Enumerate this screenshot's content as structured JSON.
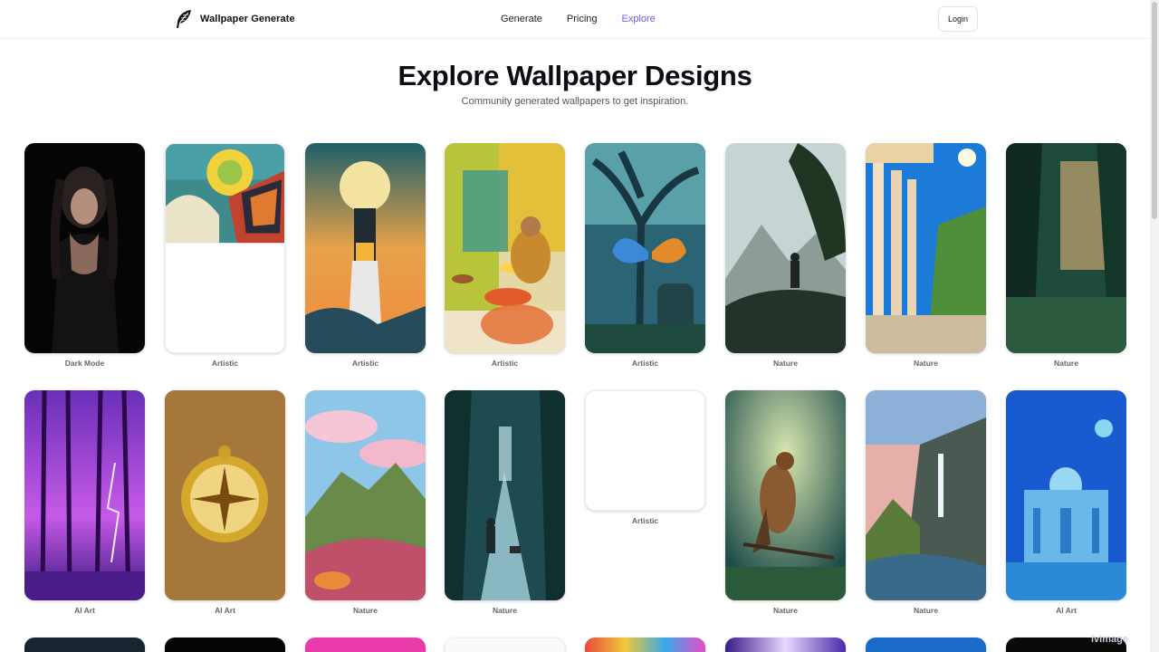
{
  "header": {
    "brand": "Wallpaper Generate",
    "nav": [
      {
        "label": "Generate",
        "active": false
      },
      {
        "label": "Pricing",
        "active": false
      },
      {
        "label": "Explore",
        "active": true
      }
    ],
    "login_label": "Login"
  },
  "hero": {
    "title": "Explore Wallpaper Designs",
    "subtitle": "Community generated wallpapers to get inspiration."
  },
  "colors": {
    "accent": "#6d5ce8",
    "text": "#111111",
    "muted": "#666666"
  },
  "cards": [
    {
      "label": "Dark Mode",
      "image": "dark-woman-portrait"
    },
    {
      "label": "Artistic",
      "image": "aztec-sun-art"
    },
    {
      "label": "Artistic",
      "image": "lighthouse-moon"
    },
    {
      "label": "Artistic",
      "image": "meditating-sage"
    },
    {
      "label": "Artistic",
      "image": "butterfly-tree"
    },
    {
      "label": "Nature",
      "image": "hiker-mountains"
    },
    {
      "label": "Nature",
      "image": "greek-columns"
    },
    {
      "label": "Nature",
      "image": "forest-light"
    },
    {
      "label": "AI Art",
      "image": "purple-forest-lightning"
    },
    {
      "label": "AI Art",
      "image": "golden-compass"
    },
    {
      "label": "Nature",
      "image": "pink-cloud-landscape"
    },
    {
      "label": "Nature",
      "image": "forest-path-walker"
    },
    {
      "label": "Artistic",
      "image": "blank"
    },
    {
      "label": "Nature",
      "image": "hawk-on-branch"
    },
    {
      "label": "Nature",
      "image": "waterfall-valley"
    },
    {
      "label": "AI Art",
      "image": "blue-palace"
    }
  ],
  "watermark": "ivImage"
}
